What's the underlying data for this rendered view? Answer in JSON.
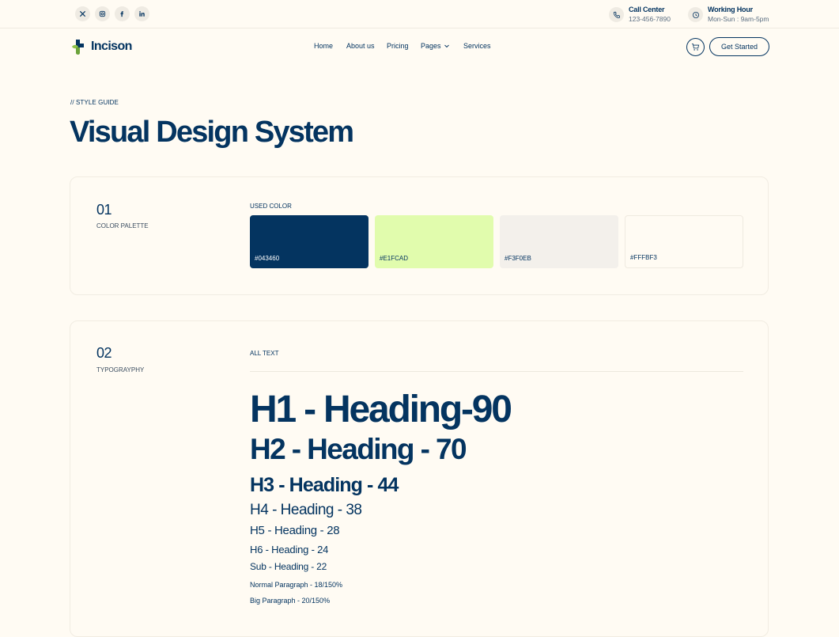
{
  "topbar": {
    "socials": [
      {
        "icon": "x-icon"
      },
      {
        "icon": "instagram-icon"
      },
      {
        "icon": "facebook-icon"
      },
      {
        "icon": "linkedin-icon"
      }
    ],
    "call": {
      "title": "Call Center",
      "value": "123-456-7890",
      "icon": "phone-icon"
    },
    "hours": {
      "title": "Working Hour",
      "value": "Mon-Sun : 9am-5pm",
      "icon": "clock-icon"
    }
  },
  "header": {
    "logo_text": "Incison",
    "nav": [
      "Home",
      "About us",
      "Pricing",
      "Pages",
      "Services"
    ],
    "cta": "Get Started",
    "cart_icon": "cart-icon"
  },
  "hero": {
    "eyebrow": "// STYLE GUIDE",
    "title": "Visual Design System"
  },
  "palette": {
    "number": "01",
    "label": "COLOR PALETTE",
    "heading": "USED  COLOR",
    "colors": [
      {
        "hex": "#043460",
        "text": "#FFFFFF"
      },
      {
        "hex": "#E1FCAD",
        "text": "#043460"
      },
      {
        "hex": "#F3F0EB",
        "text": "#043460"
      },
      {
        "hex": "#FFFBF3",
        "text": "#043460"
      }
    ]
  },
  "typography": {
    "number": "02",
    "label": "TYPOGRAYPHY",
    "heading": "ALL TEXT",
    "h1": "H1 - Heading-90",
    "h2": "H2 - Heading - 70",
    "h3": "H3 - Heading - 44",
    "h4": "H4 - Heading - 38",
    "h5": "H5 - Heading - 28",
    "h6": "H6 - Heading - 24",
    "sub": "Sub - Heading - 22",
    "para": "Normal Paragraph - 18/150%",
    "bigpara": "Big Paragraph - 20/150%"
  }
}
